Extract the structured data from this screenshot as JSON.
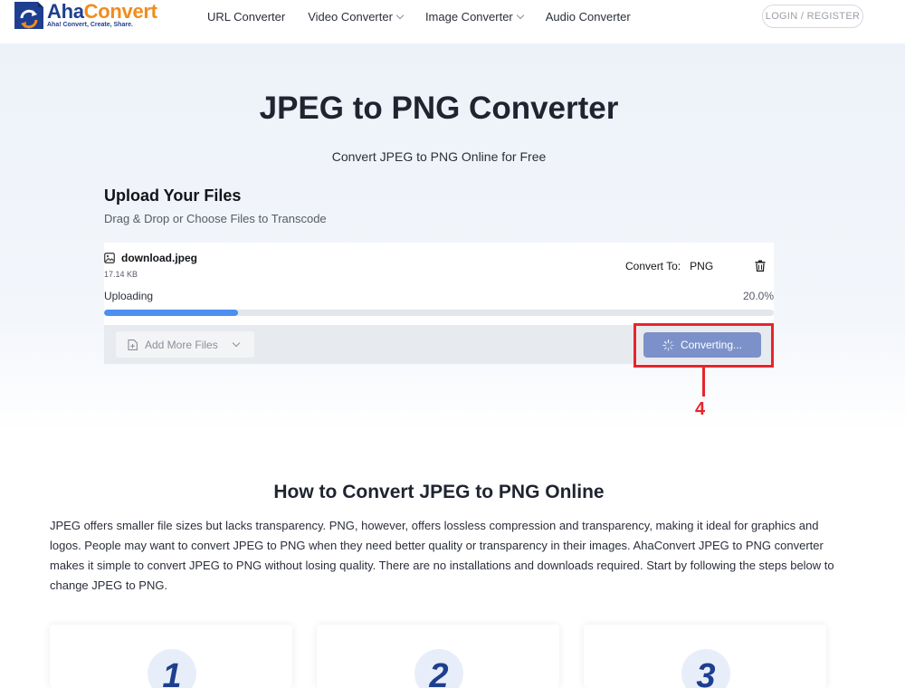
{
  "brand": {
    "name_part1": "Aha",
    "name_part2": "Convert",
    "tagline": "Aha! Convert, Create, Share."
  },
  "nav": {
    "items": [
      {
        "label": "URL Converter",
        "dropdown": false
      },
      {
        "label": "Video Converter",
        "dropdown": true
      },
      {
        "label": "Image Converter",
        "dropdown": true
      },
      {
        "label": "Audio Converter",
        "dropdown": false
      }
    ],
    "login_label": "LOGIN / REGISTER"
  },
  "hero": {
    "title": "JPEG to PNG Converter",
    "subtitle": "Convert JPEG to PNG Online for Free"
  },
  "upload": {
    "title": "Upload Your Files",
    "subtitle": "Drag & Drop or Choose Files to Transcode",
    "file": {
      "name": "download.jpeg",
      "size": "17.14 KB",
      "convert_to_label": "Convert To:",
      "convert_to_format": "PNG",
      "status": "Uploading",
      "percent_text": "20.0%",
      "progress": 0.2
    },
    "add_more_label": "Add More Files",
    "converting_label": "Converting..."
  },
  "annotation": {
    "step_number": "4"
  },
  "howto": {
    "title": "How to Convert JPEG to PNG Online",
    "text": "JPEG offers smaller file sizes but lacks transparency. PNG, however, offers lossless compression and transparency, making it ideal for graphics and logos. People may want to convert JPEG to PNG when they need better quality or transparency in their images. AhaConvert JPEG to PNG converter makes it simple to convert JPEG to PNG without losing quality. There are no installations and downloads required. Start by following the steps below to change JPEG to PNG.",
    "steps": [
      "1",
      "2",
      "3"
    ]
  },
  "colors": {
    "brand_blue": "#1e3f8f",
    "brand_orange": "#f28c1b",
    "progress": "#4d8ff0",
    "converting_button": "#7c91c9",
    "annotation_red": "#e6262c"
  }
}
